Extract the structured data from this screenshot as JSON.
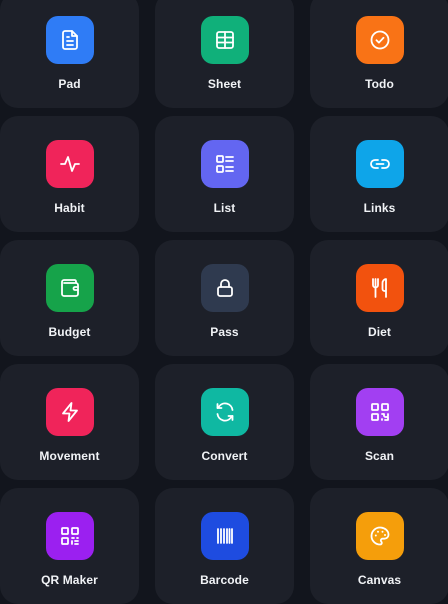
{
  "tiles": [
    {
      "label": "Pad",
      "icon": "document-icon",
      "color": "#2f7cf6"
    },
    {
      "label": "Sheet",
      "icon": "table-icon",
      "color": "#10b07a"
    },
    {
      "label": "Todo",
      "icon": "check-circle-icon",
      "color": "#f97316"
    },
    {
      "label": "Habit",
      "icon": "activity-icon",
      "color": "#f0245a"
    },
    {
      "label": "List",
      "icon": "list-icon",
      "color": "#6366f1"
    },
    {
      "label": "Links",
      "icon": "link-icon",
      "color": "#0ea5e9"
    },
    {
      "label": "Budget",
      "icon": "wallet-icon",
      "color": "#16a34a"
    },
    {
      "label": "Pass",
      "icon": "lock-icon",
      "color": "#2f3a4f"
    },
    {
      "label": "Diet",
      "icon": "utensils-icon",
      "color": "#f2520e"
    },
    {
      "label": "Movement",
      "icon": "lightning-icon",
      "color": "#f0245a"
    },
    {
      "label": "Convert",
      "icon": "refresh-icon",
      "color": "#0fb8a2"
    },
    {
      "label": "Scan",
      "icon": "qr-scan-icon",
      "color": "#a23ff2"
    },
    {
      "label": "QR Maker",
      "icon": "qr-code-icon",
      "color": "#9b20f0"
    },
    {
      "label": "Barcode",
      "icon": "barcode-icon",
      "color": "#1e4ce0"
    },
    {
      "label": "Canvas",
      "icon": "palette-icon",
      "color": "#f59e0b"
    }
  ]
}
